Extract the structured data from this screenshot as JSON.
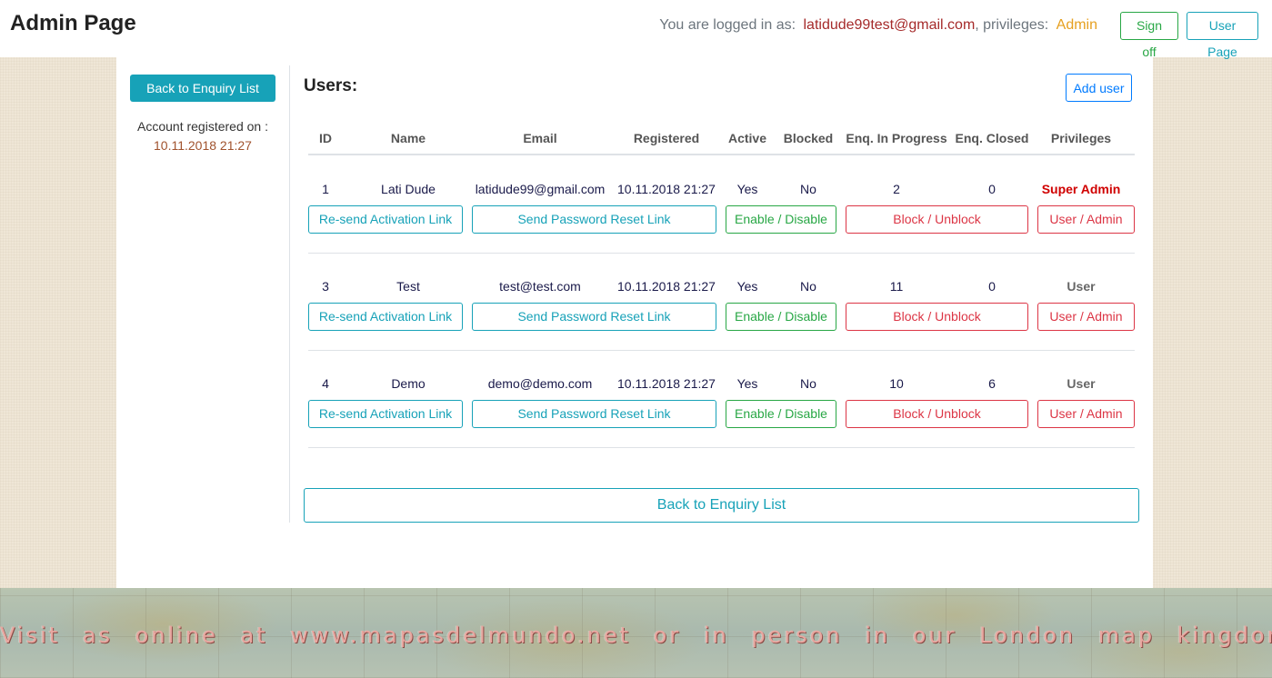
{
  "header": {
    "title": "Admin Page",
    "logged_in_prefix": "You are logged in as:",
    "user_email": "latidude99test@gmail.com",
    "privileges_prefix": ", privileges:",
    "privileges_value": "Admin",
    "sign_off_label": "Sign off",
    "user_page_label": "User Page"
  },
  "sidebar": {
    "back_button_label": "Back to Enquiry List",
    "account_registered_label": "Account registered on :",
    "account_registered_date": "10.11.2018 21:27"
  },
  "main": {
    "title": "Users:",
    "add_user_label": "Add user",
    "columns": [
      "ID",
      "Name",
      "Email",
      "Registered",
      "Active",
      "Blocked",
      "Enq. In Progress",
      "Enq. Closed",
      "Privileges"
    ],
    "actions": {
      "resend": "Re-send Activation Link",
      "reset": "Send Password Reset Link",
      "enable": "Enable / Disable",
      "block": "Block / Unblock",
      "privilege": "User / Admin"
    },
    "users": [
      {
        "id": "1",
        "name": "Lati Dude",
        "email": "latidude99@gmail.com",
        "registered": "10.11.2018 21:27",
        "active": "Yes",
        "blocked": "No",
        "in_progress": "2",
        "closed": "0",
        "privileges": "Super Admin"
      },
      {
        "id": "3",
        "name": "Test",
        "email": "test@test.com",
        "registered": "10.11.2018 21:27",
        "active": "Yes",
        "blocked": "No",
        "in_progress": "11",
        "closed": "0",
        "privileges": "User"
      },
      {
        "id": "4",
        "name": "Demo",
        "email": "demo@demo.com",
        "registered": "10.11.2018 21:27",
        "active": "Yes",
        "blocked": "No",
        "in_progress": "10",
        "closed": "6",
        "privileges": "User"
      }
    ],
    "bottom_back_label": "Back to Enquiry List"
  },
  "footer": {
    "text": "Visit as online at www.mapasdelmundo.net or in person in our London map kingdom!"
  },
  "colors": {
    "teal": "#17a2b8",
    "green": "#28a745",
    "red": "#dc3545",
    "super_admin": "#d00000",
    "admin_label": "#e6a020"
  }
}
